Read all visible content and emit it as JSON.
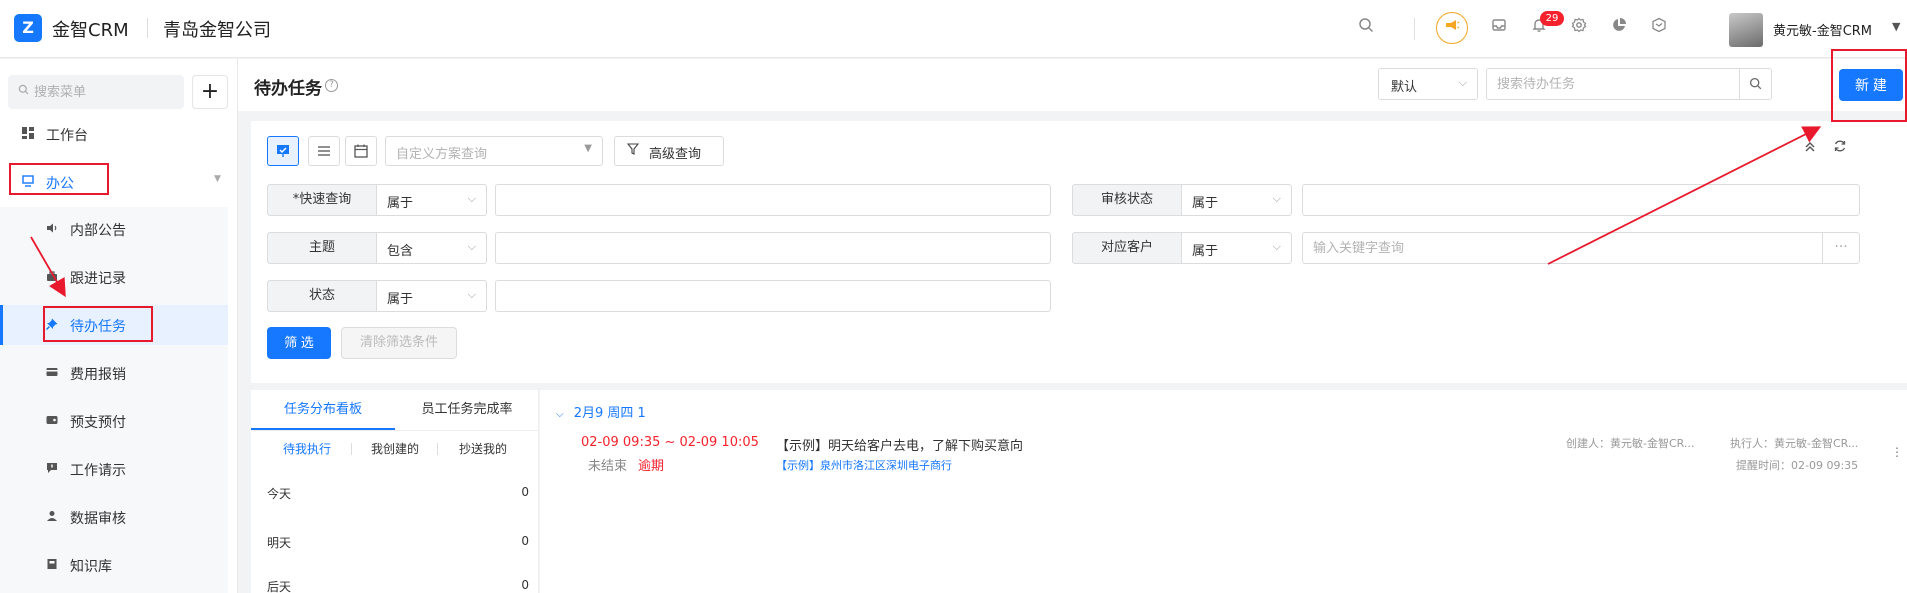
{
  "header": {
    "logo_glyph": "Z",
    "brand": "金智CRM",
    "company": "青岛金智公司",
    "notification_count": "29",
    "user_name": "黄元敏-金智CRM",
    "icons": [
      "search-icon",
      "megaphone-icon",
      "inbox-icon",
      "bell-icon",
      "gear-icon",
      "pie-chart-icon",
      "cube-icon",
      "chevron-down-icon"
    ]
  },
  "sidebar": {
    "search_placeholder": "搜索菜单",
    "add_label": "+",
    "items": [
      {
        "label": "工作台",
        "icon": "dashboard-icon"
      },
      {
        "label": "办公",
        "icon": "monitor-icon"
      }
    ],
    "subitems": [
      {
        "label": "内部公告",
        "icon": "speaker-icon"
      },
      {
        "label": "跟进记录",
        "icon": "bag-icon"
      },
      {
        "label": "待办任务",
        "icon": "pin-icon"
      },
      {
        "label": "费用报销",
        "icon": "card-icon"
      },
      {
        "label": "预支预付",
        "icon": "wallet-icon"
      },
      {
        "label": "工作请示",
        "icon": "message-icon"
      },
      {
        "label": "数据审核",
        "icon": "user-icon"
      },
      {
        "label": "知识库",
        "icon": "book-icon"
      }
    ]
  },
  "titlebar": {
    "title": "待办任务",
    "help": "?",
    "scope_value": "默认",
    "search_placeholder": "搜索待办任务",
    "new_label": "新 建"
  },
  "filter": {
    "scheme_placeholder": "自定义方案查询",
    "advanced_label": "高级查询",
    "rows": [
      {
        "label": "*快速查询",
        "op": "属于",
        "placeholder": ""
      },
      {
        "label": "审核状态",
        "op": "属于",
        "placeholder": ""
      },
      {
        "label": "主题",
        "op": "包含",
        "placeholder": ""
      },
      {
        "label": "对应客户",
        "op": "属于",
        "placeholder": "输入关键字查询"
      },
      {
        "label": "状态",
        "op": "属于",
        "placeholder": ""
      }
    ],
    "dots": "···",
    "filter_label": "筛 选",
    "clear_label": "清除筛选条件"
  },
  "stats": {
    "tabs": [
      "任务分布看板",
      "员工任务完成率"
    ],
    "subtabs": [
      "待我执行",
      "我创建的",
      "抄送我的"
    ],
    "rows": [
      {
        "label": "今天",
        "value": "0"
      },
      {
        "label": "明天",
        "value": "0"
      },
      {
        "label": "后天",
        "value": "0"
      }
    ]
  },
  "tasks": {
    "date_group": "2月9  周四  1",
    "items": [
      {
        "time": "02-09 09:35 ~ 02-09 10:05",
        "status": "未结束",
        "overdue": "逾期",
        "subject": "【示例】明天给客户去电，了解下购买意向",
        "customer": "【示例】泉州市洛江区深圳电子商行",
        "creator": "创建人：黄元敏-金智CR...",
        "executor": "执行人：黄元敏-金智CR...",
        "remind": "提醒时间：02-09 09:35"
      }
    ]
  },
  "annotation_color": "#e8192c"
}
